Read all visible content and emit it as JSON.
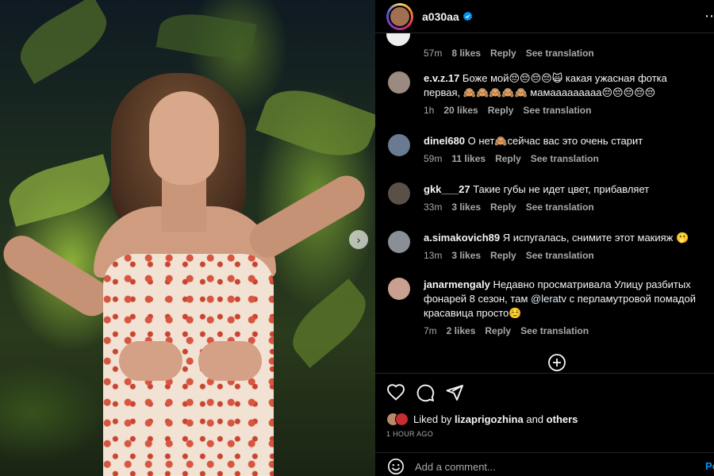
{
  "photo": {
    "next_icon": "chevron-right-icon"
  },
  "header": {
    "username": "a030aa",
    "verified_icon": "verified-badge-icon"
  },
  "previous_comment_meta": {
    "time": "57m",
    "likes": "8 likes",
    "reply": "Reply",
    "translate": "See translation"
  },
  "comments": [
    {
      "username": "e.v.z.17",
      "text": "Боже мой😔😔😔😔🙀 какая ужасная фотка первая, 🙈🙈🙈🙈🙈 мамааааааааа😔😔😔😔😔",
      "time": "1h",
      "likes": "20 likes",
      "reply": "Reply",
      "translate": "See translation",
      "avatar_color": "#9a8a80"
    },
    {
      "username": "dinel680",
      "text": "О нет🙈сейчас вас это очень старит",
      "time": "59m",
      "likes": "11 likes",
      "reply": "Reply",
      "translate": "See translation",
      "avatar_color": "#6a7a90"
    },
    {
      "username": "gkk___27",
      "text": "Такие губы не идет цвет, прибавляет",
      "time": "33m",
      "likes": "3 likes",
      "reply": "Reply",
      "translate": "See translation",
      "avatar_color": "#5a5048"
    },
    {
      "username": "a.simakovich89",
      "text": "Я испугалась, снимите этот макияж 🫢",
      "time": "13m",
      "likes": "3 likes",
      "reply": "Reply",
      "translate": "See translation",
      "avatar_color": "#8a8f96"
    },
    {
      "username": "janarmengaly",
      "text_before": "Недавно просматривала Улицу разбитых фонарей 8 сезон, там ",
      "mention": "@leratv",
      "text_after": " с перламутровой помадой красавица просто☺️",
      "time": "7m",
      "likes": "2 likes",
      "reply": "Reply",
      "translate": "See translation",
      "avatar_color": "#c9a090"
    }
  ],
  "load_more_icon": "plus-circle-icon",
  "actions": {
    "like_icon": "heart-icon",
    "comment_icon": "comment-icon",
    "share_icon": "send-icon",
    "liked_by_prefix": "Liked by",
    "liked_by_user": "lizaprigozhina",
    "liked_by_suffix": "and",
    "liked_by_others": "others",
    "time_ago": "1 HOUR AGO"
  },
  "add_comment": {
    "placeholder": "Add a comment...",
    "post_label": "Po",
    "emoji_icon": "emoji-icon"
  },
  "colors": {
    "background": "#000000",
    "text": "#f5f5f5",
    "secondary": "#a8a8a8",
    "accent": "#0095f6",
    "verified": "#0095f6"
  }
}
